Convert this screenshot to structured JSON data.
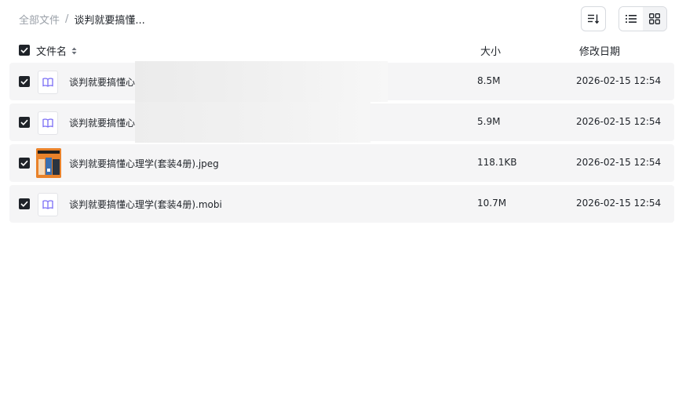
{
  "breadcrumb": {
    "root": "全部文件",
    "separator": "/",
    "current": "谈判就要搞懂..."
  },
  "toolbar": {
    "sort_icon": "sort-list-icon",
    "list_view_icon": "list-view-icon",
    "grid_view_icon": "grid-view-icon"
  },
  "table": {
    "columns": {
      "name": "文件名",
      "size": "大小",
      "date": "修改日期"
    },
    "rows": [
      {
        "name": "谈判就要搞懂心",
        "size": "8.5M",
        "date": "2026-02-15 12:54",
        "icon": "book-file-icon",
        "checked": true
      },
      {
        "name": "谈判就要搞懂心",
        "size": "5.9M",
        "date": "2026-02-15 12:54",
        "icon": "book-file-icon",
        "checked": true
      },
      {
        "name": "谈判就要搞懂心理学(套装4册).jpeg",
        "size": "118.1KB",
        "date": "2026-02-15 12:54",
        "icon": "image-thumbnail",
        "checked": true
      },
      {
        "name": "谈判就要搞懂心理学(套装4册).mobi",
        "size": "10.7M",
        "date": "2026-02-15 12:54",
        "icon": "book-file-icon",
        "checked": true
      }
    ]
  },
  "colors": {
    "row_bg": "#f5f5f6",
    "checkbox": "#1f2329",
    "book_icon": "#7b6ef6"
  }
}
